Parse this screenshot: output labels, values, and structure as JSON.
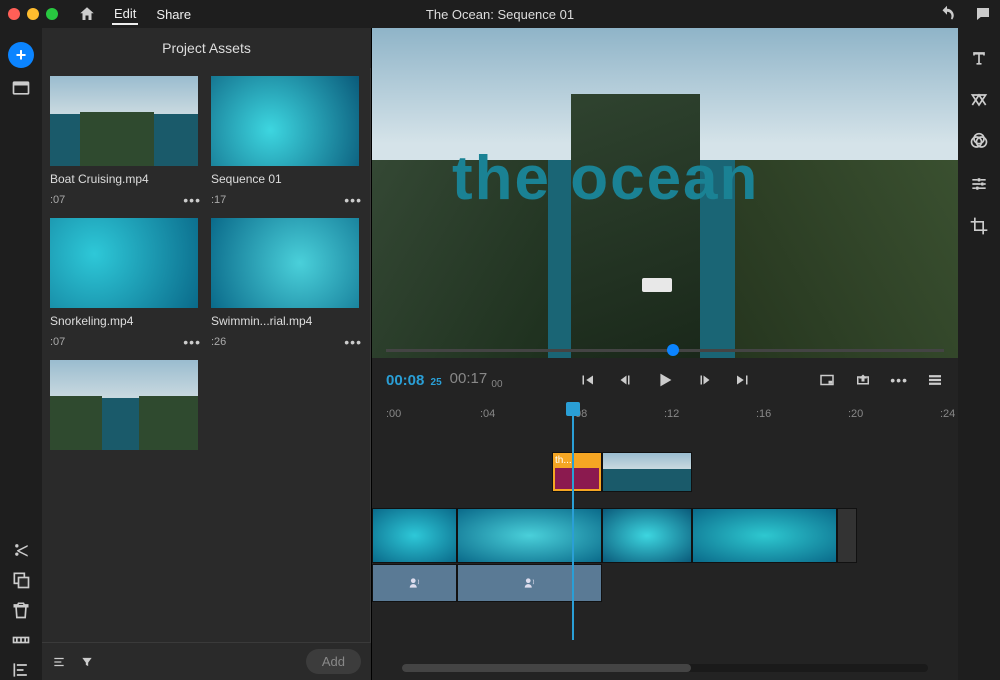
{
  "titlebar": {
    "title": "The Ocean: Sequence 01",
    "tabs": {
      "edit": "Edit",
      "share": "Share"
    }
  },
  "assets_panel": {
    "title": "Project Assets",
    "add_label": "Add",
    "items": [
      {
        "name": "Boat Cruising.mp4",
        "dur": ":07"
      },
      {
        "name": "Sequence 01",
        "dur": ":17"
      },
      {
        "name": "Snorkeling.mp4",
        "dur": ":07"
      },
      {
        "name": "Swimmin...rial.mp4",
        "dur": ":26"
      },
      {
        "name": "",
        "dur": ""
      }
    ]
  },
  "preview": {
    "overlay_text": "the ocean"
  },
  "playback": {
    "current": "00:08",
    "current_frames": "25",
    "total": "00:17",
    "total_frames": "00"
  },
  "ruler": [
    ":00",
    ":04",
    ":08",
    ":12",
    ":16",
    ":20",
    ":24"
  ],
  "timeline": {
    "title_clip": "th..."
  }
}
